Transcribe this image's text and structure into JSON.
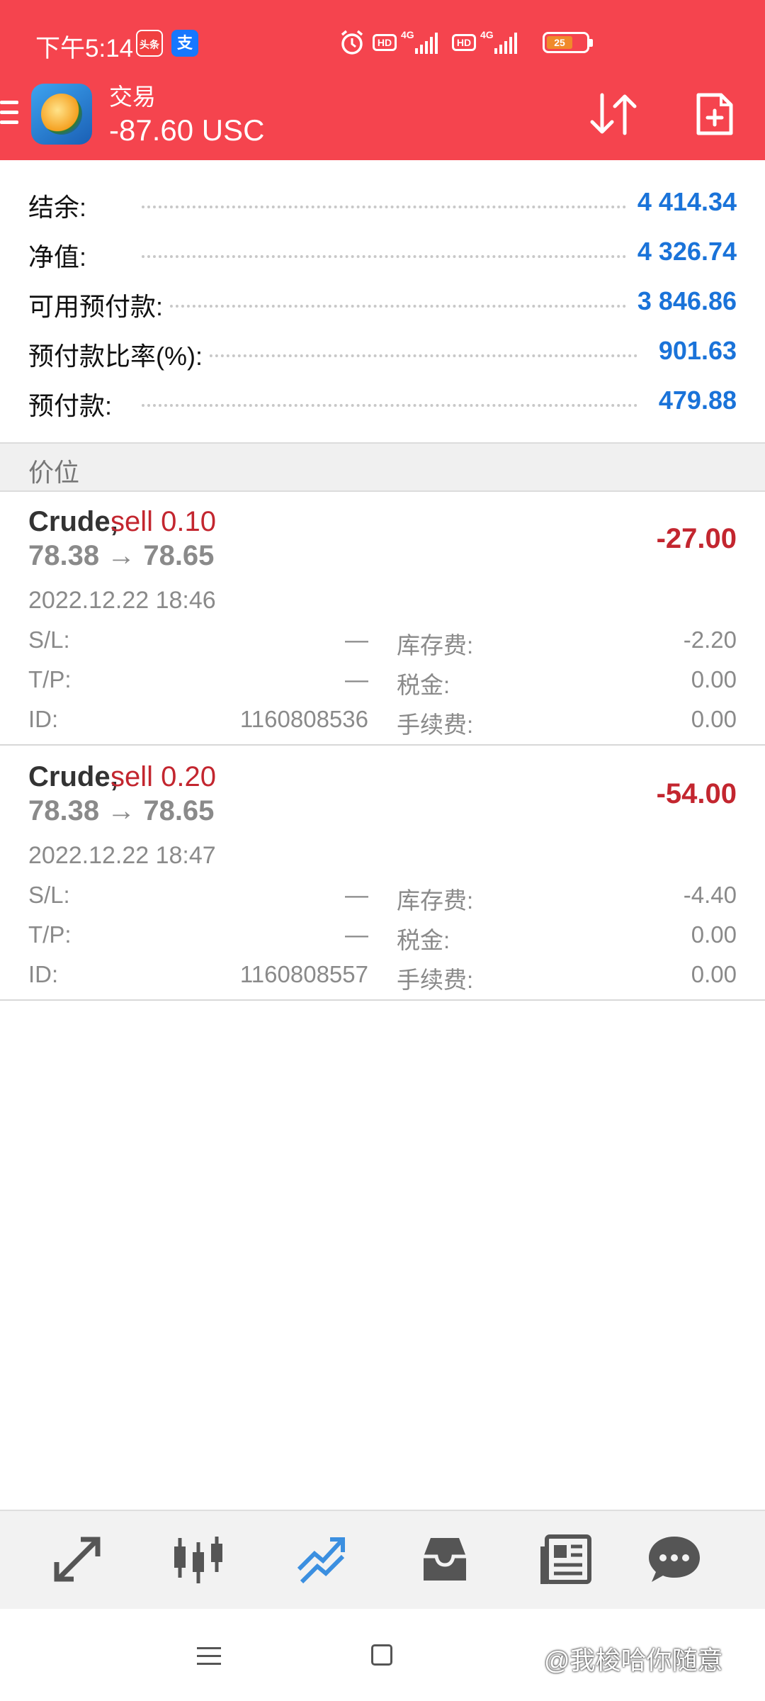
{
  "status_bar": {
    "time": "下午5:14",
    "app_badge_1": "头条",
    "app_badge_2": "支",
    "battery": "25"
  },
  "header": {
    "title": "交易",
    "subtitle": "-87.60 USC"
  },
  "summary": {
    "rows": [
      {
        "label": "结余:",
        "value": "4 414.34"
      },
      {
        "label": "净值:",
        "value": "4 326.74"
      },
      {
        "label": "可用预付款:",
        "value": "3 846.86"
      },
      {
        "label": "预付款比率(%):",
        "value": "901.63"
      },
      {
        "label": "预付款:",
        "value": "479.88"
      }
    ]
  },
  "section": {
    "title": "价位"
  },
  "positions": [
    {
      "symbol": "Crude,",
      "side": "sell 0.10",
      "price": "78.38 → 78.65",
      "profit": "-27.00",
      "time": "2022.12.22 18:46",
      "sl_label": "S/L:",
      "sl_value": "—",
      "tp_label": "T/P:",
      "tp_value": "—",
      "id_label": "ID:",
      "id_value": "1160808536",
      "swap_label": "库存费:",
      "swap_value": "-2.20",
      "tax_label": "税金:",
      "tax_value": "0.00",
      "fee_label": "手续费:",
      "fee_value": "0.00"
    },
    {
      "symbol": "Crude,",
      "side": "sell 0.20",
      "price": "78.38 → 78.65",
      "profit": "-54.00",
      "time": "2022.12.22 18:47",
      "sl_label": "S/L:",
      "sl_value": "—",
      "tp_label": "T/P:",
      "tp_value": "—",
      "id_label": "ID:",
      "id_value": "1160808557",
      "swap_label": "库存费:",
      "swap_value": "-4.40",
      "tax_label": "税金:",
      "tax_value": "0.00",
      "fee_label": "手续费:",
      "fee_value": "0.00"
    }
  ],
  "bottom_nav": [
    {
      "icon": "quotes-icon"
    },
    {
      "icon": "chart-icon"
    },
    {
      "icon": "trade-icon",
      "active": true
    },
    {
      "icon": "history-icon"
    },
    {
      "icon": "news-icon"
    },
    {
      "icon": "chat-icon"
    }
  ],
  "watermark": "@我梭哈你随意",
  "colors": {
    "header": "#f5444e",
    "value_blue": "#1a73d9",
    "loss_red": "#c3262f",
    "active_nav": "#3b8fe0"
  }
}
